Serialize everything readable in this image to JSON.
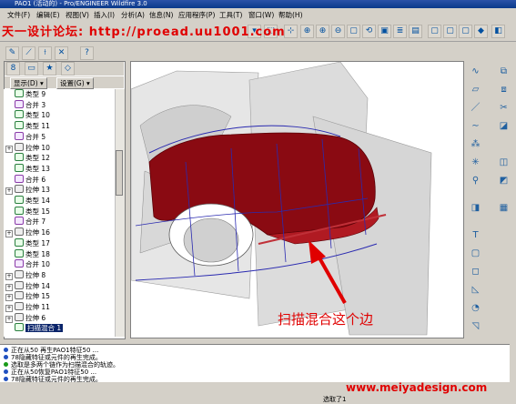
{
  "window": {
    "title": "PAO1 (活动的) - Pro/ENGINEER Wildfire 3.0"
  },
  "watermark": {
    "text": "天一设计论坛: http://proead.uu1001.com"
  },
  "menu": [
    "文件(F)",
    "编辑(E)",
    "视图(V)",
    "插入(I)",
    "分析(A)",
    "信息(N)",
    "应用程序(P)",
    "工具(T)",
    "窗口(W)",
    "帮助(H)"
  ],
  "panel": {
    "show_label": "显示(D)",
    "settings_label": "设置(G)"
  },
  "tree": [
    {
      "label": "类型 9",
      "kind": "sweep"
    },
    {
      "label": "合并 3",
      "kind": "merge"
    },
    {
      "label": "类型 10",
      "kind": "sweep"
    },
    {
      "label": "类型 11",
      "kind": "sweep"
    },
    {
      "label": "合并 5",
      "kind": "merge"
    },
    {
      "label": "拉伸 10",
      "kind": "extrude",
      "expand": true
    },
    {
      "label": "类型 12",
      "kind": "sweep"
    },
    {
      "label": "类型 13",
      "kind": "sweep"
    },
    {
      "label": "合并 6",
      "kind": "merge"
    },
    {
      "label": "拉伸 13",
      "kind": "extrude",
      "expand": true
    },
    {
      "label": "类型 14",
      "kind": "sweep"
    },
    {
      "label": "类型 15",
      "kind": "sweep"
    },
    {
      "label": "合并 7",
      "kind": "merge"
    },
    {
      "label": "拉伸 16",
      "kind": "extrude",
      "expand": true
    },
    {
      "label": "类型 17",
      "kind": "sweep"
    },
    {
      "label": "类型 18",
      "kind": "sweep"
    },
    {
      "label": "合并 10",
      "kind": "merge"
    },
    {
      "label": "拉伸 8",
      "kind": "extrude",
      "expand": true
    },
    {
      "label": "拉伸 14",
      "kind": "extrude",
      "expand": true
    },
    {
      "label": "拉伸 15",
      "kind": "extrude",
      "expand": true
    },
    {
      "label": "拉伸 11",
      "kind": "extrude",
      "expand": true
    },
    {
      "label": "拉伸 6",
      "kind": "extrude",
      "expand": true
    },
    {
      "label": "扫描混合 1",
      "kind": "sweep",
      "selected": true
    }
  ],
  "messages": [
    "正在从50 再生PAO1特征50 ...",
    "78隐藏特征或元件的再生完成。",
    "选取是多两个链作为扫描混合的轨迹。",
    "正在从50恢复PAO1特征50 ...",
    "78隐藏特征或元件的再生完成。"
  ],
  "annotation": {
    "text": "扫描混合这个边",
    "color": "#e00000"
  },
  "site": {
    "text": "www.meiyadesign.com"
  },
  "status": {
    "filter_label": "选取了1"
  },
  "colors": {
    "car_body": "#8a0a12",
    "accent": "#e00000"
  }
}
